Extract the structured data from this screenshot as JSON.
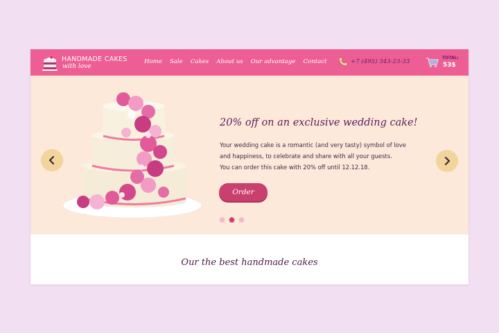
{
  "brand": {
    "title": "HANDMADE CAKES",
    "subtitle": "with love"
  },
  "nav": {
    "items": [
      {
        "label": "Home"
      },
      {
        "label": "Sale"
      },
      {
        "label": "Cakes"
      },
      {
        "label": "About us"
      },
      {
        "label": "Our advantage"
      },
      {
        "label": "Contact"
      }
    ]
  },
  "contact": {
    "phone": "+7 (495) 343-23-33",
    "icon": "phone-icon"
  },
  "cart": {
    "label": "TOTAL:",
    "total": "53$",
    "icon": "cart-icon"
  },
  "hero": {
    "title": "20% off on an exclusive wedding cake!",
    "text_lines": [
      "Your wedding cake is a romantic (and very tasty) symbol of love",
      "and happiness, to celebrate and share with all your guests.",
      "You can order this cake with 20% off until 12.12.18."
    ],
    "button": "Order",
    "slides": 3,
    "active_slide": 2
  },
  "section": {
    "title": "Our the best handmade cakes"
  },
  "colors": {
    "header": "#ec5e94",
    "hero_bg": "#fce9da",
    "accent": "#c9406e",
    "arrow_bg": "#f2d49d",
    "text_dark": "#5c1a5c",
    "page_bg": "#f2dff1"
  }
}
